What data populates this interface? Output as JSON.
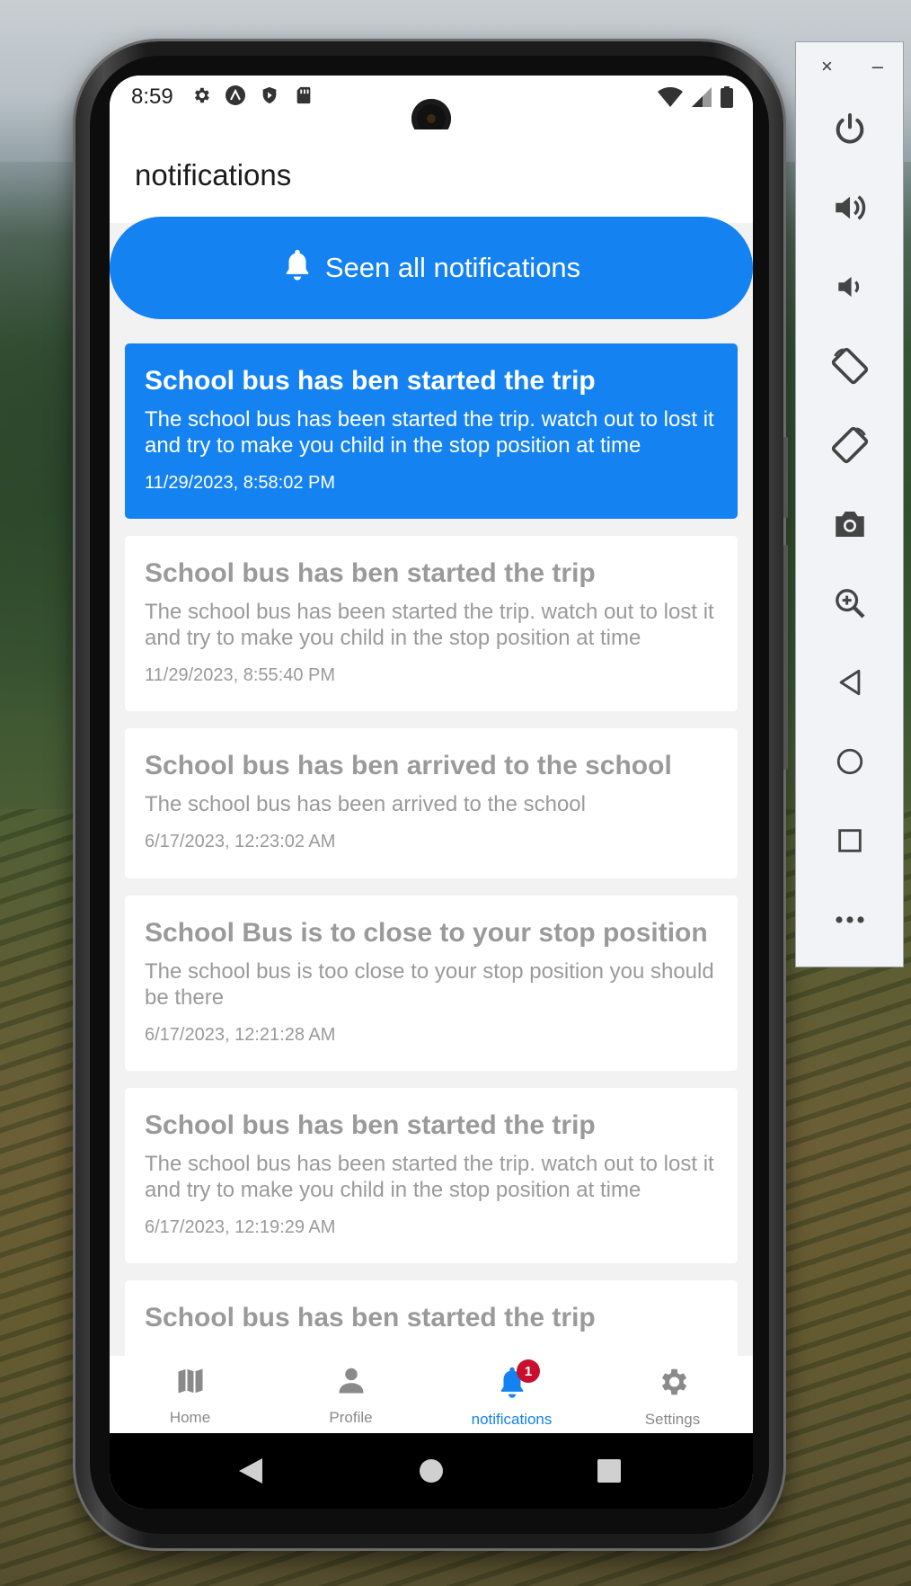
{
  "status_bar": {
    "time": "8:59"
  },
  "header": {
    "title": "notifications"
  },
  "seen_all_button": {
    "label": "Seen all notifications"
  },
  "notifications": [
    {
      "title": "School bus has ben started the trip",
      "body": "The school bus has been started the trip. watch out to lost it and try to make you child in the stop position at time",
      "date": "11/29/2023, 8:58:02 PM",
      "unread": true
    },
    {
      "title": "School bus has ben started the trip",
      "body": "The school bus has been started the trip. watch out to lost it and try to make you child in the stop position at time",
      "date": "11/29/2023, 8:55:40 PM",
      "unread": false
    },
    {
      "title": "School bus has ben arrived to the school",
      "body": "The school bus has been arrived to the school",
      "date": "6/17/2023, 12:23:02 AM",
      "unread": false
    },
    {
      "title": "School Bus is to close to your stop position",
      "body": "The school bus is too close to your stop position you should be there",
      "date": "6/17/2023, 12:21:28 AM",
      "unread": false
    },
    {
      "title": "School bus has ben started the trip",
      "body": "The school bus has been started the trip. watch out to lost it and try to make you child in the stop position at time",
      "date": "6/17/2023, 12:19:29 AM",
      "unread": false
    },
    {
      "title": "School bus has ben started the trip",
      "body": "",
      "date": "",
      "unread": false
    }
  ],
  "bottom_nav": {
    "items": [
      {
        "label": "Home",
        "icon": "map-icon",
        "active": false
      },
      {
        "label": "Profile",
        "icon": "person-icon",
        "active": false
      },
      {
        "label": "notifications",
        "icon": "bell-icon",
        "active": true,
        "badge": "1"
      },
      {
        "label": "Settings",
        "icon": "gear-icon",
        "active": false
      }
    ]
  },
  "colors": {
    "accent": "#1482f0",
    "badge": "#c8102e",
    "muted_text": "#9a9a9a"
  },
  "emulator_toolbar": {
    "close": "×",
    "minimize": "–",
    "buttons": [
      "power-icon",
      "volume-up-icon",
      "volume-down-icon",
      "rotate-left-icon",
      "rotate-right-icon",
      "camera-icon",
      "zoom-icon",
      "back-icon",
      "home-icon",
      "overview-icon",
      "more-icon"
    ]
  }
}
